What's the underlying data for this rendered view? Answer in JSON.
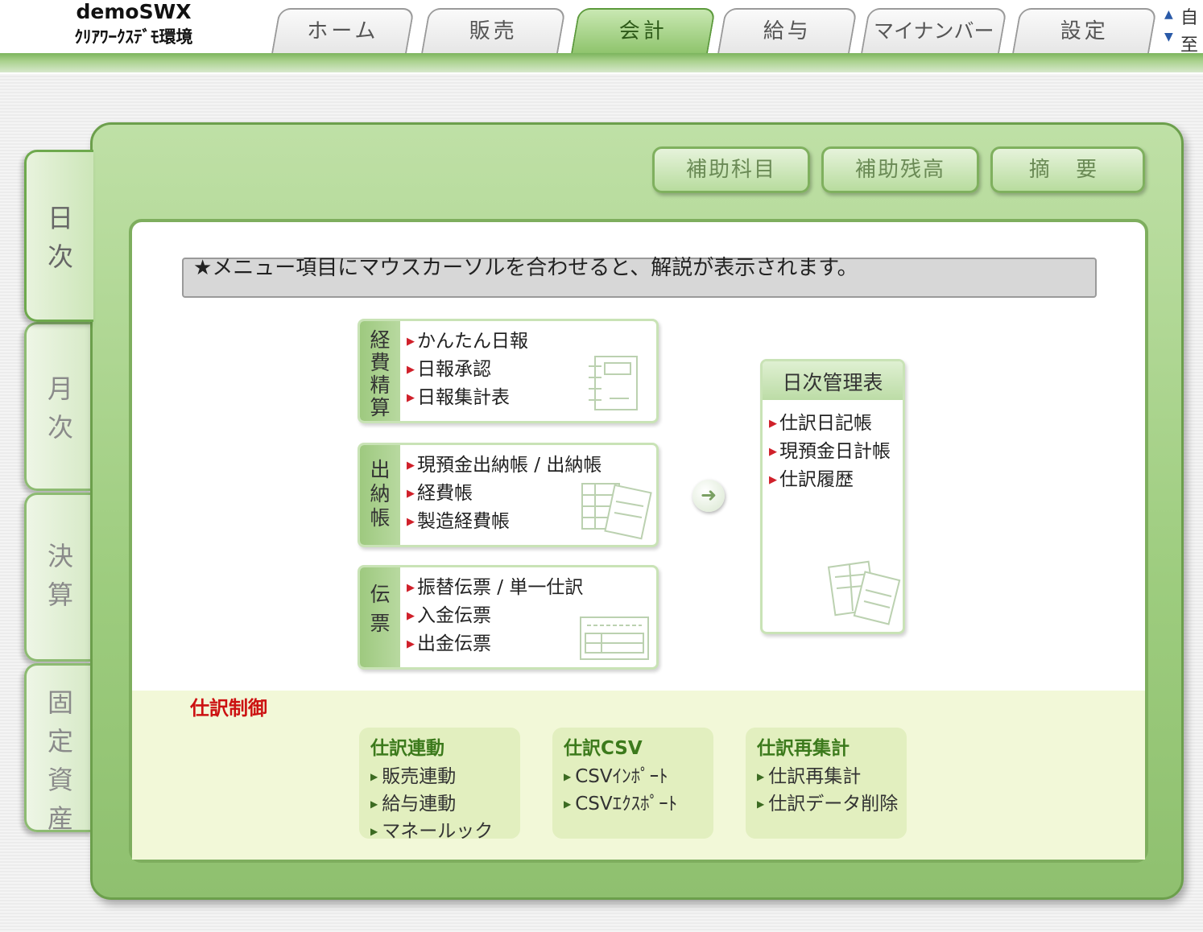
{
  "company": {
    "name": "demoSWX",
    "env": "ｸﾘｱﾜｰｸｽﾃﾞﾓ環境"
  },
  "tabs": [
    "ホーム",
    "販売",
    "会計",
    "給与",
    "マイナンバー",
    "設定"
  ],
  "tabs_active": "会計",
  "corner": {
    "up_label": "自",
    "down_label": "至"
  },
  "side_tabs": {
    "daily": [
      "日",
      "次"
    ],
    "monthly": [
      "月",
      "次"
    ],
    "closing": [
      "決",
      "算"
    ],
    "assets": [
      "固",
      "定",
      "資",
      "産"
    ]
  },
  "sub_buttons": {
    "sub_account": "補助科目",
    "sub_balance": "補助残高",
    "summary": "摘 要"
  },
  "hint": "★メニュー項目にマウスカーソルを合わせると、解説が表示されます。",
  "expense": {
    "side": [
      "経",
      "費",
      "精",
      "算"
    ],
    "items": [
      "かんたん日報",
      "日報承認",
      "日報集計表"
    ]
  },
  "ledger": {
    "side": [
      "出",
      "納",
      "帳"
    ],
    "items": [
      "現預金出納帳 / 出納帳",
      "経費帳",
      "製造経費帳"
    ]
  },
  "voucher": {
    "side": [
      "伝",
      "票"
    ],
    "items": [
      "振替伝票 / 単一仕訳",
      "入金伝票",
      "出金伝票"
    ]
  },
  "daily_mgmt": {
    "title": "日次管理表",
    "items": [
      "仕訳日記帳",
      "現預金日計帳",
      "仕訳履歴"
    ]
  },
  "control": {
    "title": "仕訳制御",
    "link": {
      "title": "仕訳連動",
      "items": [
        "販売連動",
        "給与連動",
        "マネールック"
      ]
    },
    "csv": {
      "title": "仕訳CSV",
      "items": [
        "CSVｲﾝﾎﾟｰﾄ",
        "CSVｴｸｽﾎﾟｰﾄ"
      ]
    },
    "recalc": {
      "title": "仕訳再集計",
      "items": [
        "仕訳再集計",
        "仕訳データ削除"
      ]
    }
  },
  "colors": {
    "accent_green": "#8fc46d",
    "control_red": "#cc1111",
    "marker_red": "#d0202a"
  }
}
